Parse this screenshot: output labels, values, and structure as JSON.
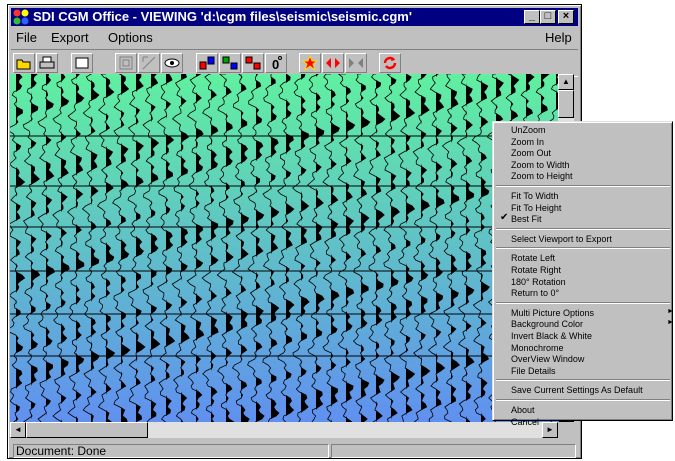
{
  "window": {
    "title": "SDI CGM Office - VIEWING 'd:\\cgm files\\seismic\\seismic.cgm'",
    "controls": [
      "_",
      "□",
      "×"
    ]
  },
  "menubar": {
    "items": [
      "File",
      "Export",
      "Options"
    ],
    "help": "Help"
  },
  "toolbar": {
    "buttons": [
      "open-icon",
      "print-icon",
      "rectangle-icon",
      "fit-icon",
      "zoom-region-icon",
      "eye-icon",
      "arrange-icon",
      "rotate-icon",
      "overlay-icon",
      "degree-icon",
      "star-icon",
      "arrows-in-icon",
      "arrows-out-icon",
      "refresh-icon"
    ]
  },
  "status": {
    "text": "Document: Done"
  },
  "context_menu": {
    "items": [
      {
        "label": "UnZoom"
      },
      {
        "label": "Zoom In"
      },
      {
        "label": "Zoom Out"
      },
      {
        "label": "Zoom to Width"
      },
      {
        "label": "Zoom to Height"
      },
      {
        "sep": true
      },
      {
        "label": "Fit To Width"
      },
      {
        "label": "Fit To Height"
      },
      {
        "label": "Best Fit",
        "checked": true
      },
      {
        "sep": true
      },
      {
        "label": "Select Viewport to Export"
      },
      {
        "sep": true
      },
      {
        "label": "Rotate Left"
      },
      {
        "label": "Rotate Right"
      },
      {
        "label": "180° Rotation"
      },
      {
        "label": "Return to 0°"
      },
      {
        "sep": true
      },
      {
        "label": "Multi Picture Options",
        "submenu": true
      },
      {
        "label": "Background Color",
        "submenu": true
      },
      {
        "label": "Invert Black & White"
      },
      {
        "label": "Monochrome"
      },
      {
        "label": "OverView Window"
      },
      {
        "label": "File Details"
      },
      {
        "sep": true
      },
      {
        "label": "Save Current Settings As Default"
      },
      {
        "sep": true
      },
      {
        "label": "About"
      },
      {
        "label": "Cancel"
      }
    ]
  },
  "colors": {
    "titlebar": "#000080",
    "gradient_top": "#60f0a0",
    "gradient_bottom": "#6090f0",
    "trace": "#000000"
  }
}
